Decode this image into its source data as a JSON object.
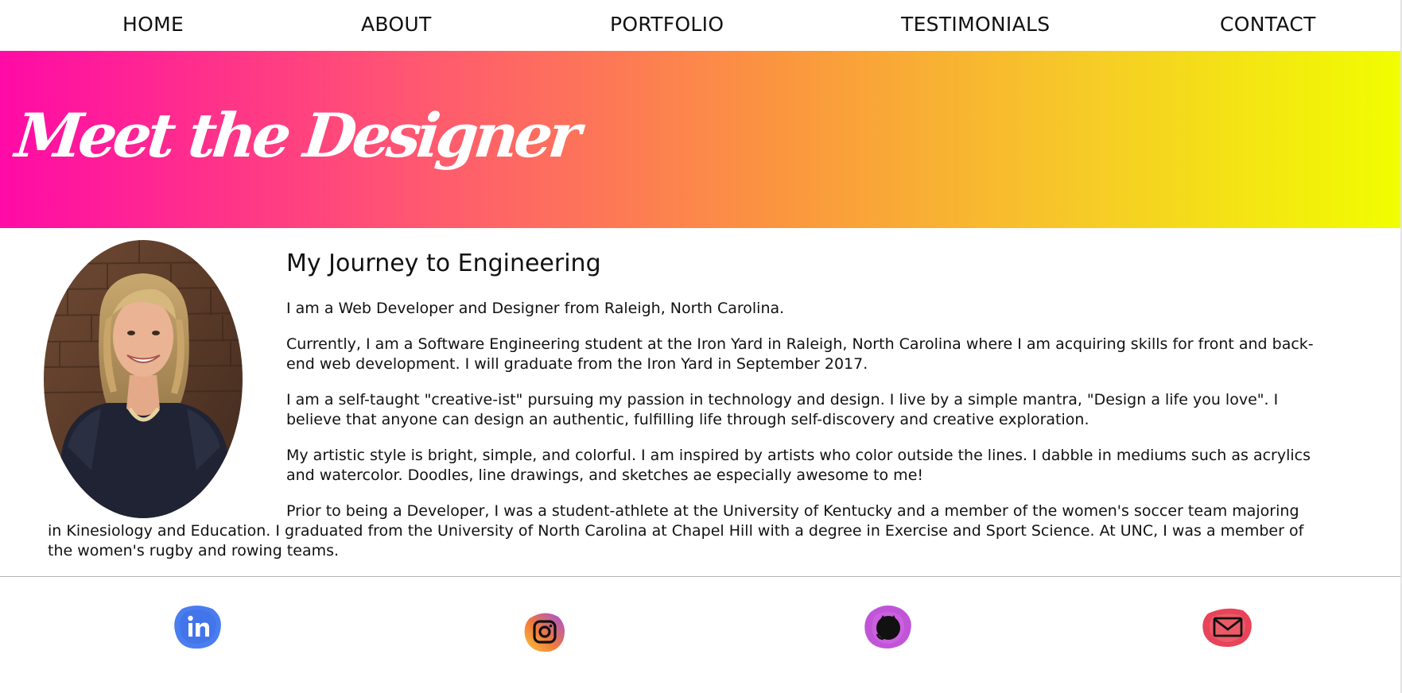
{
  "nav": {
    "items": [
      {
        "label": "HOME"
      },
      {
        "label": "ABOUT"
      },
      {
        "label": "PORTFOLIO"
      },
      {
        "label": "TESTIMONIALS"
      },
      {
        "label": "CONTACT"
      }
    ]
  },
  "banner": {
    "title": "Meet the Designer",
    "gradient": [
      "#ff0aa6",
      "#ff5870",
      "#fb9440",
      "#f6cc26",
      "#f1fe00"
    ]
  },
  "about": {
    "heading": "My Journey to Engineering",
    "paragraphs": [
      "I am a Web Developer and Designer from Raleigh, North Carolina.",
      "Currently, I am a Software Engineering student at the Iron Yard in Raleigh, North Carolina where I am acquiring skills for front and back-end web development. I will graduate from the Iron Yard in September 2017.",
      "I am a self-taught \"creative-ist\" pursuing my passion in technology and design. I live by a simple mantra, \"Design a life you love\". I believe that anyone can design an authentic, fulfilling life through self-discovery and creative exploration.",
      "My artistic style is bright, simple, and colorful. I am inspired by artists who color outside the lines. I dabble in mediums such as acrylics and watercolor. Doodles, line drawings, and sketches ae especially awesome to me!",
      "Prior to being a Developer, I was a student-athlete at the University of Kentucky and a member of the women's soccer team majoring in Kinesiology and Education. I graduated from the University of North Carolina at Chapel Hill with a degree in Exercise and Sport Science. At UNC, I was a member of the women's rugby and rowing teams."
    ]
  },
  "social": {
    "icons": [
      {
        "icon": "linkedin-icon",
        "color": "#4a7df0"
      },
      {
        "icon": "instagram-icon",
        "color": "#e9823a"
      },
      {
        "icon": "github-icon",
        "color": "#c055d8"
      },
      {
        "icon": "mail-icon",
        "color": "#e84358"
      }
    ]
  }
}
